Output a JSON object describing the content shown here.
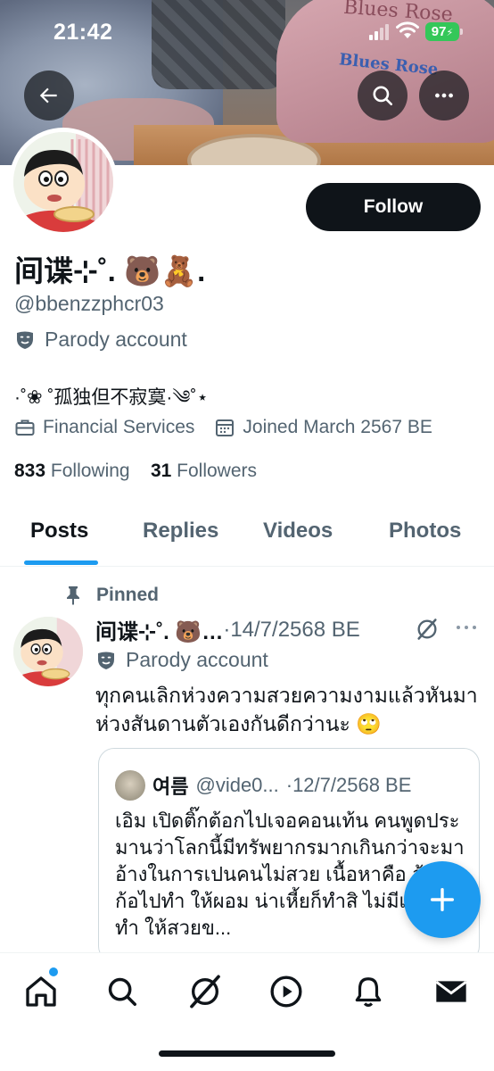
{
  "status_bar": {
    "time": "21:42",
    "battery": "97"
  },
  "header": {
    "back_icon": "arrow-left-icon",
    "search_icon": "search-icon",
    "more_icon": "more-horizontal-icon"
  },
  "banner": {
    "cap_text_top": "Blues Rose",
    "cap_text_logo": "Blues Rose"
  },
  "profile": {
    "display_name": "间谍⊹˚. 🐻🧸.",
    "handle": "@bbenzzphcr03",
    "parody_label": "Parody account",
    "bio": "·˚❀ ˚孤独但不寂寞·༄˚⋆",
    "category": "Financial Services",
    "joined": "Joined March 2567 BE",
    "following_count": "833",
    "following_label": "Following",
    "followers_count": "31",
    "followers_label": "Followers",
    "follow_label": "Follow"
  },
  "tabs": [
    {
      "label": "Posts",
      "active": true
    },
    {
      "label": "Replies",
      "active": false
    },
    {
      "label": "Videos",
      "active": false
    },
    {
      "label": "Photos",
      "active": false
    }
  ],
  "pinned_tweet": {
    "pinned_label": "Pinned",
    "author_name": "间谍⊹˚. 🐻…",
    "date": "·14/7/2568 BE",
    "parody_label": "Parody account",
    "text": "ทุกคนเลิกห่วงความสวยความงามแล้วหันมาห่วงสันดานตัวเองกันดีกว่านะ 🙄",
    "quote": {
      "author_name": "여름",
      "handle": "@vide0...",
      "date": "·12/7/2568 BE",
      "text": "เอิม เปิดติ๊กต้อกไปเจอคอนเท้น คนพูดประมานว่าโลกนี้มีทรัพยากรมากเกินกว่าจะมาอ้างในการเปนคนไม่สวย เนื้อหาคือ อ้วนก้อไปทำ ให้ผอม น่าเหี้ยก็ทำสิ ไม่มีเงินไปทำ ให้สวยข..."
    }
  },
  "colors": {
    "accent": "#1d9bf0",
    "text": "#0f1419",
    "secondary": "#536471",
    "battery": "#34c759"
  },
  "bottom_nav": [
    {
      "icon": "home-icon",
      "active": true,
      "badge": true
    },
    {
      "icon": "search-icon"
    },
    {
      "icon": "grok-icon"
    },
    {
      "icon": "play-icon"
    },
    {
      "icon": "bell-icon"
    },
    {
      "icon": "mail-icon"
    }
  ]
}
